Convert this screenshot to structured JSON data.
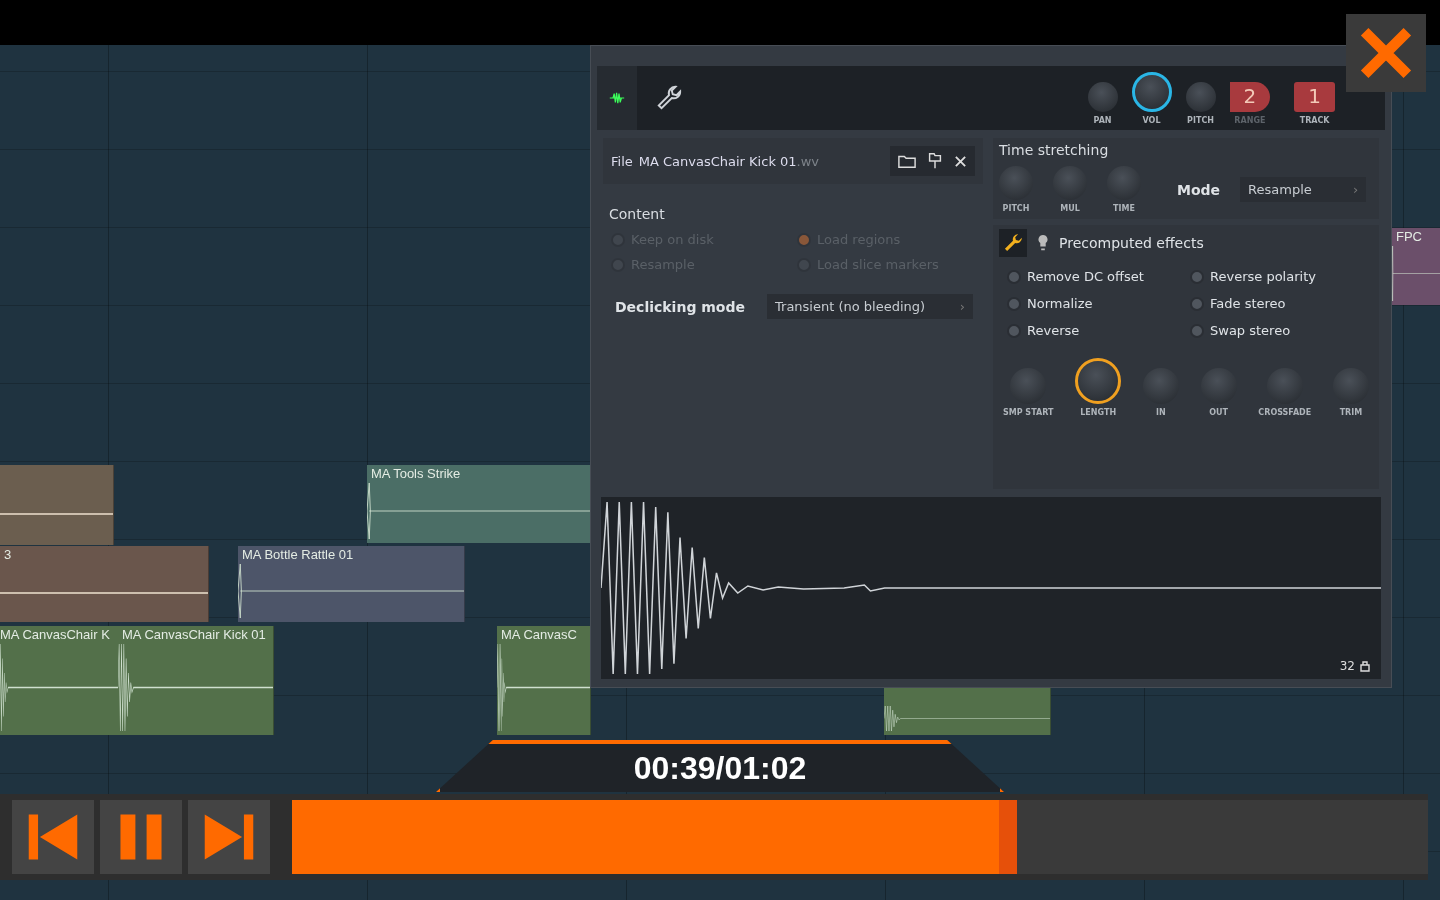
{
  "playlist": {
    "clips": [
      {
        "color": "#6b5e4f",
        "kind": "flat"
      },
      {
        "label": "3",
        "color": "#6a564c",
        "kind": "flat"
      },
      {
        "label": "MA Tools Strike",
        "color": "#4b6e66",
        "kind": "hit"
      },
      {
        "label": "MA Bottle Rattle 01",
        "color": "#4d5569",
        "kind": "hit"
      },
      {
        "label": "MA CanvasChair K",
        "color": "#53704a",
        "kind": "kick"
      },
      {
        "label": "MA CanvasChair Kick 01",
        "color": "#53704a",
        "kind": "kick"
      },
      {
        "label": "MA CanvasC",
        "color": "#53704a",
        "kind": "kick"
      },
      {
        "color": "#53704a",
        "kind": "kick"
      },
      {
        "label": "FPC",
        "color": "#6b4f6a",
        "kind": "hit"
      }
    ]
  },
  "channel_window": {
    "header_knobs": [
      {
        "label": "PAN",
        "active": false
      },
      {
        "label": "VOL",
        "active": true
      },
      {
        "label": "PITCH",
        "active": false
      }
    ],
    "range": {
      "value": "2",
      "label": "RANGE"
    },
    "track": {
      "value": "1",
      "label": "TRACK"
    },
    "file": {
      "label": "File",
      "name": "MA CanvasChair Kick 01",
      "ext": ".wv"
    },
    "content": {
      "title": "Content",
      "options": [
        {
          "label": "Keep on disk",
          "checked": false,
          "disabled": true
        },
        {
          "label": "Load regions",
          "checked": true,
          "disabled": true
        },
        {
          "label": "Resample",
          "checked": false,
          "disabled": true
        },
        {
          "label": "Load slice markers",
          "checked": false,
          "disabled": true
        }
      ]
    },
    "declicking": {
      "label": "Declicking mode",
      "value": "Transient (no bleeding)",
      "caret": "›"
    },
    "time_stretching": {
      "title": "Time stretching",
      "knobs": [
        {
          "label": "PITCH",
          "active": false
        },
        {
          "label": "MUL",
          "active": false
        },
        {
          "label": "TIME",
          "active": false
        }
      ],
      "mode_label": "Mode",
      "mode_value": "Resample",
      "caret": "›"
    },
    "precomputed": {
      "title": "Precomputed effects",
      "options": [
        {
          "label": "Remove DC offset",
          "checked": false
        },
        {
          "label": "Reverse polarity",
          "checked": false
        },
        {
          "label": "Normalize",
          "checked": false
        },
        {
          "label": "Fade stereo",
          "checked": false
        },
        {
          "label": "Reverse",
          "checked": false
        },
        {
          "label": "Swap stereo",
          "checked": false
        }
      ],
      "knobs": [
        {
          "label": "SMP START",
          "active": false
        },
        {
          "label": "LENGTH",
          "active": true
        },
        {
          "label": "IN",
          "active": false
        },
        {
          "label": "OUT",
          "active": false
        },
        {
          "label": "CROSSFADE",
          "active": false
        },
        {
          "label": "TRIM",
          "active": false
        }
      ]
    },
    "zoom_value": "32"
  },
  "player": {
    "time": "00:39/01:02",
    "progress": {
      "level": 0.638
    }
  }
}
